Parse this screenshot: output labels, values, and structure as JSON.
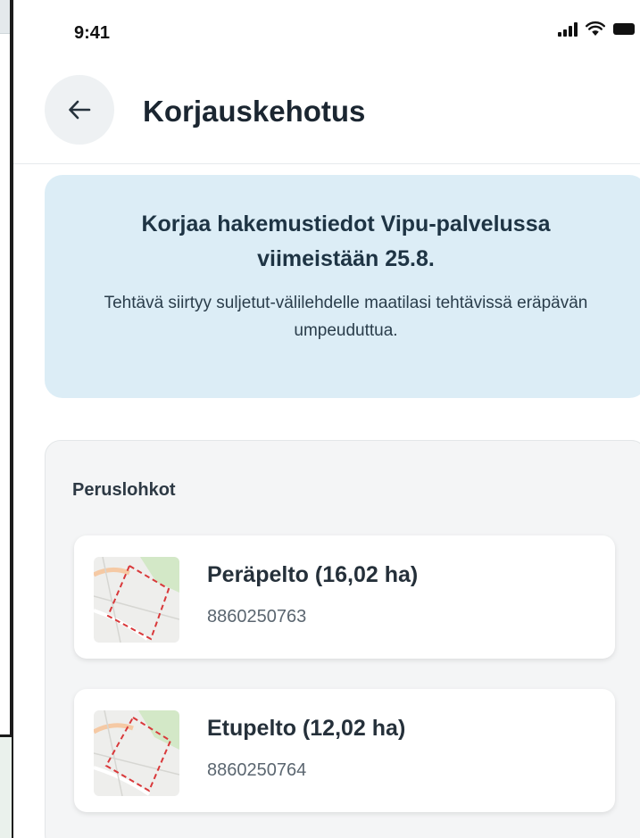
{
  "status_bar": {
    "time": "9:41",
    "icons": [
      "signal-icon",
      "wifi-icon",
      "battery-icon"
    ]
  },
  "header": {
    "back_icon": "arrow-left-icon",
    "title": "Korjauskehotus"
  },
  "banner": {
    "headline": "Korjaa hakemustiedot Vipu-palvelussa viimeistään 25.8.",
    "body": "Tehtävä siirtyy suljetut-välilehdelle maatilasi tehtävissä eräpävän umpeuduttua."
  },
  "parcels": {
    "section_title": "Peruslohkot",
    "items": [
      {
        "name": "Peräpelto (16,02 ha)",
        "id": "8860250763",
        "thumbnail": "map-thumbnail"
      },
      {
        "name": "Etupelto (12,02 ha)",
        "id": "8860250764",
        "thumbnail": "map-thumbnail"
      }
    ]
  },
  "colors": {
    "banner_bg": "#dcedf6",
    "section_bg": "#f4f5f6",
    "page_bg": "#ffffff",
    "outer_bg": "#eaf1ec"
  }
}
